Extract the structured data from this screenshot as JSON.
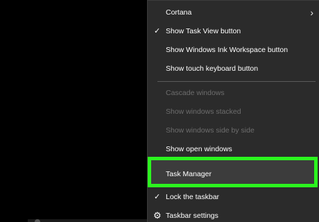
{
  "menu": {
    "cortana": "Cortana",
    "show_task_view": "Show Task View button",
    "show_ink_workspace": "Show Windows Ink Workspace button",
    "show_touch_keyboard": "Show touch keyboard button",
    "cascade": "Cascade windows",
    "stacked": "Show windows stacked",
    "side_by_side": "Show windows side by side",
    "show_open": "Show open windows",
    "task_manager": "Task Manager",
    "lock_taskbar": "Lock the taskbar",
    "taskbar_settings": "Taskbar settings"
  },
  "icons": {
    "check": "checkmark-icon",
    "chevron": "chevron-right-icon",
    "gear": "gear-icon"
  },
  "colors": {
    "menu_bg": "#2b2b2b",
    "highlight_border": "#2cf51f",
    "disabled_text": "#6d6d6d"
  }
}
